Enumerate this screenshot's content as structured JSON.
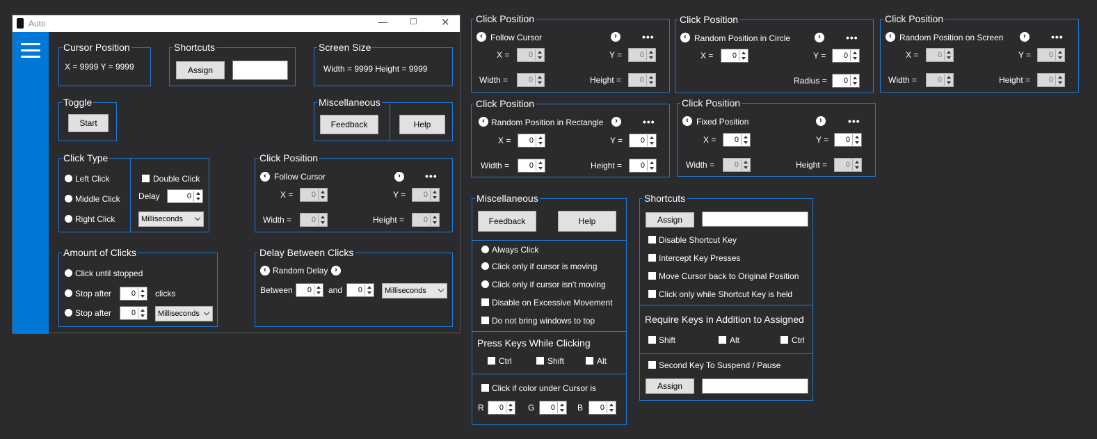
{
  "window": {
    "title": "Auto"
  },
  "main": {
    "cursor_position": {
      "title": "Cursor Position",
      "value": "X = 9999 Y = 9999"
    },
    "shortcuts": {
      "title": "Shortcuts",
      "assign": "Assign"
    },
    "screen_size": {
      "title": "Screen Size",
      "value": "Width = 9999 Height = 9999"
    },
    "toggle": {
      "title": "Toggle",
      "start": "Start"
    },
    "misc": {
      "title": "Miscellaneous",
      "feedback": "Feedback",
      "help": "Help"
    },
    "click_type": {
      "title": "Click Type",
      "left": "Left Click",
      "middle": "Middle Click",
      "right": "Right Click",
      "double": "Double Click",
      "delay": "Delay",
      "delay_value": "0",
      "unit": "Milliseconds"
    },
    "click_position": {
      "title": "Click Position",
      "mode": "Follow Cursor",
      "x": "X =",
      "y": "Y =",
      "width": "Width =",
      "height": "Height =",
      "x_val": "0",
      "y_val": "0",
      "w_val": "0",
      "h_val": "0"
    },
    "amount": {
      "title": "Amount of Clicks",
      "until": "Click until stopped",
      "stop1": "Stop after",
      "stop1_val": "0",
      "clicks": "clicks",
      "stop2": "Stop after",
      "stop2_val": "0",
      "unit": "Milliseconds"
    },
    "delay_between": {
      "title": "Delay Between Clicks",
      "mode": "Random Delay",
      "between": "Between",
      "and": "and",
      "v1": "0",
      "v2": "0",
      "unit": "Milliseconds"
    }
  },
  "panels": {
    "cp1": {
      "title": "Click Position",
      "mode": "Follow Cursor",
      "x": "X =",
      "y": "Y =",
      "width": "Width =",
      "height": "Height =",
      "x_val": "0",
      "y_val": "0",
      "w_val": "0",
      "h_val": "0"
    },
    "cp2": {
      "title": "Click Position",
      "mode": "Random Position in Circle",
      "x": "X =",
      "y": "Y =",
      "radius": "Radius =",
      "x_val": "0",
      "y_val": "0",
      "r_val": "0"
    },
    "cp3": {
      "title": "Click Position",
      "mode": "Random Position on Screen",
      "x": "X =",
      "y": "Y =",
      "width": "Width =",
      "height": "Height =",
      "x_val": "0",
      "y_val": "0",
      "w_val": "0",
      "h_val": "0"
    },
    "cp4": {
      "title": "Click Position",
      "mode": "Random Position in Rectangle",
      "x": "X =",
      "y": "Y =",
      "width": "Width =",
      "height": "Height =",
      "x_val": "0",
      "y_val": "0",
      "w_val": "0",
      "h_val": "0"
    },
    "cp5": {
      "title": "Click Position",
      "mode": "Fixed Position",
      "x": "X =",
      "y": "Y =",
      "width": "Width =",
      "height": "Height =",
      "x_val": "0",
      "y_val": "0",
      "w_val": "0",
      "h_val": "0"
    },
    "misc": {
      "title": "Miscellaneous",
      "feedback": "Feedback",
      "help": "Help",
      "always": "Always Click",
      "moving": "Click only if cursor is moving",
      "not_moving": "Click only if cursor isn't moving",
      "disable_excess": "Disable on Excessive Movement",
      "no_top": "Do not bring windows to top",
      "press_keys": "Press Keys While Clicking",
      "ctrl": "Ctrl",
      "shift": "Shift",
      "alt": "Alt",
      "color": "Click if color under Cursor is",
      "r": "R",
      "g": "G",
      "b": "B",
      "r_val": "0",
      "g_val": "0",
      "b_val": "0"
    },
    "shortcuts": {
      "title": "Shortcuts",
      "assign": "Assign",
      "disable": "Disable Shortcut Key",
      "intercept": "Intercept Key Presses",
      "move_back": "Move Cursor back to Original Position",
      "while_held": "Click only while Shortcut Key is held",
      "require": "Require Keys in Addition to Assigned",
      "shift": "Shift",
      "alt": "Alt",
      "ctrl": "Ctrl",
      "second": "Second Key To Suspend / Pause",
      "assign2": "Assign"
    }
  }
}
